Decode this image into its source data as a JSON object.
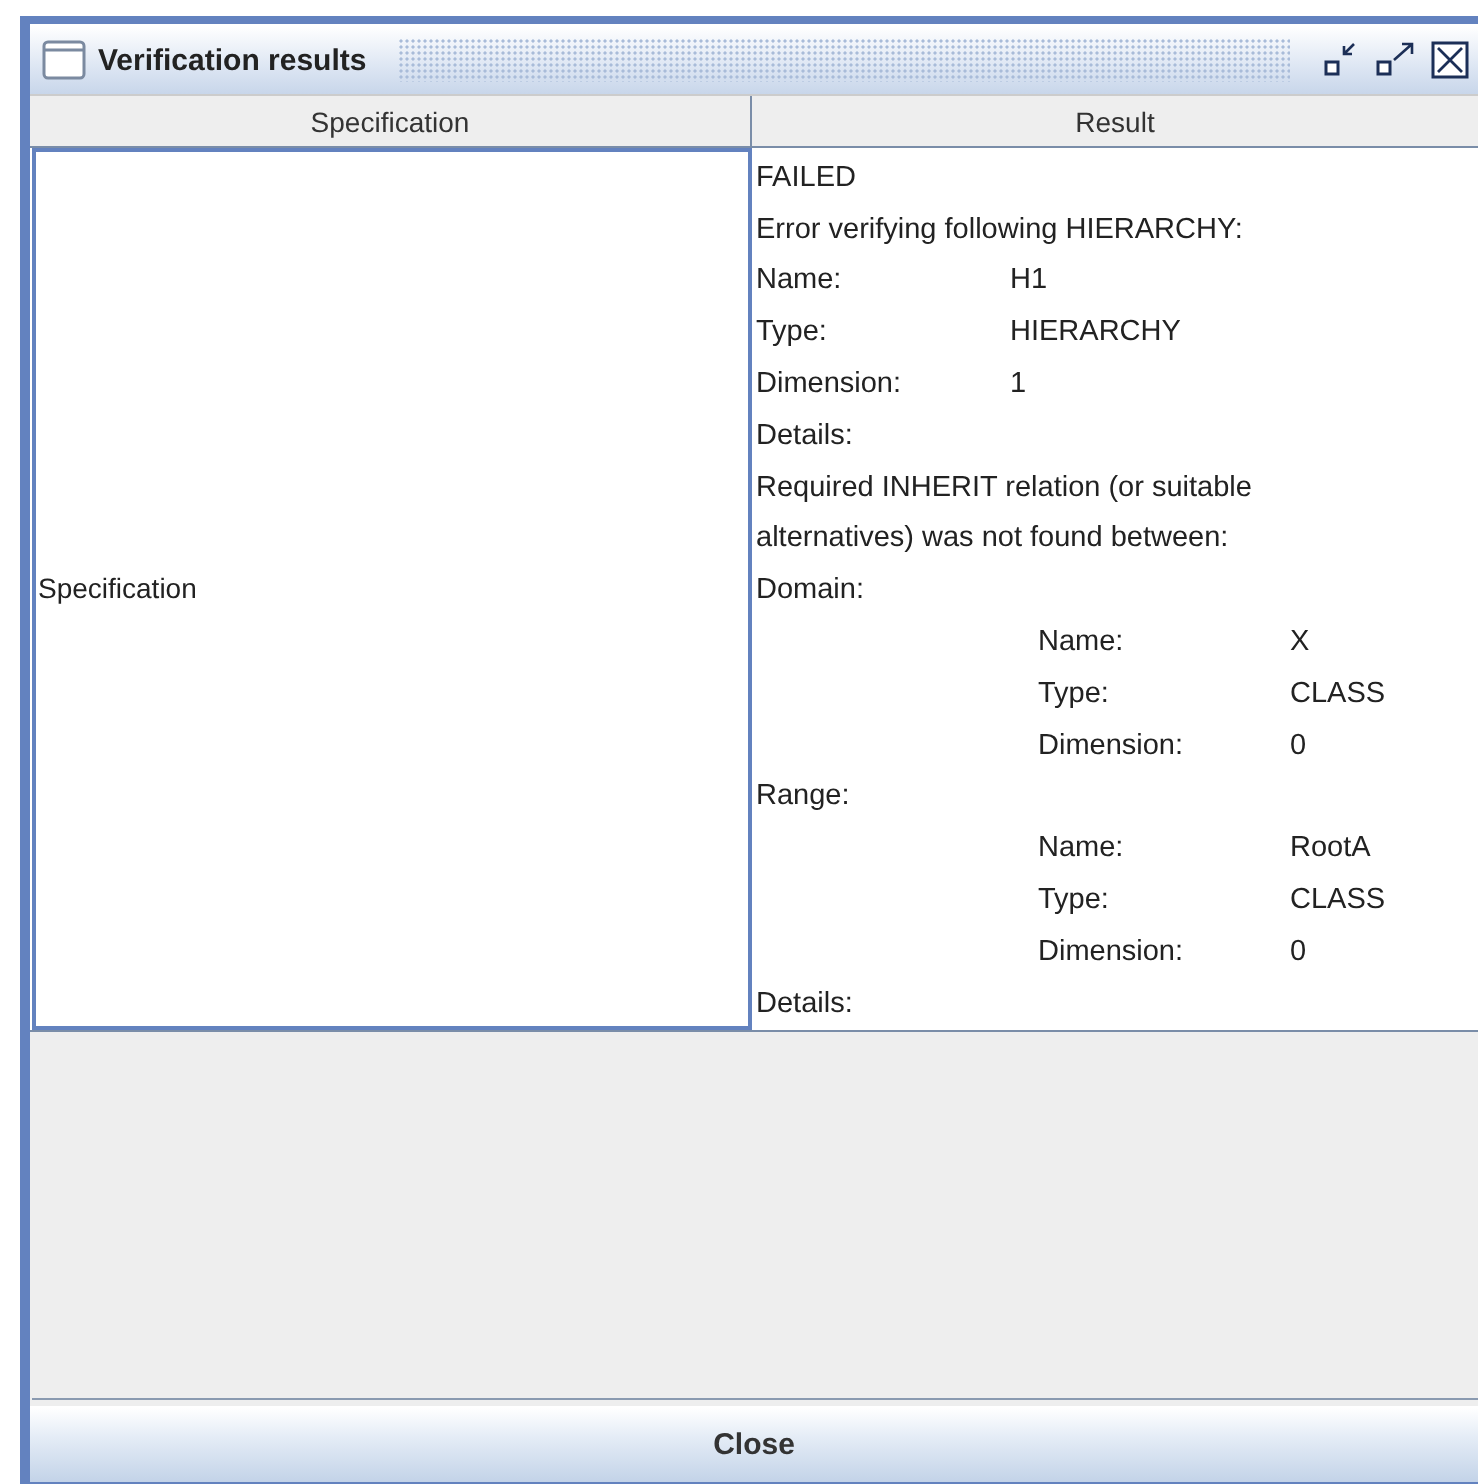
{
  "window": {
    "title": "Verification results"
  },
  "table": {
    "columns": [
      "Specification",
      "Result"
    ],
    "rows": [
      {
        "specification": "Specification",
        "result": [
          {
            "kind": "text",
            "text": "FAILED"
          },
          {
            "kind": "text",
            "text": "Error verifying following HIERARCHY:"
          },
          {
            "kind": "field",
            "label": "Name:",
            "value": "H1"
          },
          {
            "kind": "field",
            "label": "Type:",
            "value": "HIERARCHY"
          },
          {
            "kind": "field",
            "label": "Dimension:",
            "value": "1"
          },
          {
            "kind": "text",
            "text": "Details:"
          },
          {
            "kind": "text",
            "text": "Required INHERIT relation (or suitable"
          },
          {
            "kind": "text",
            "text": "alternatives) was not found between:"
          },
          {
            "kind": "text",
            "text": "Domain:"
          },
          {
            "kind": "subfield",
            "label": "Name:",
            "value": "X"
          },
          {
            "kind": "subfield",
            "label": "Type:",
            "value": "CLASS"
          },
          {
            "kind": "subfield",
            "label": "Dimension:",
            "value": "0"
          },
          {
            "kind": "text",
            "text": "Range:"
          },
          {
            "kind": "subfield",
            "label": "Name:",
            "value": "RootA"
          },
          {
            "kind": "subfield",
            "label": "Type:",
            "value": "CLASS"
          },
          {
            "kind": "subfield",
            "label": "Dimension:",
            "value": "0"
          },
          {
            "kind": "text",
            "text": "Details:"
          }
        ]
      }
    ]
  },
  "buttons": [
    "Close"
  ]
}
